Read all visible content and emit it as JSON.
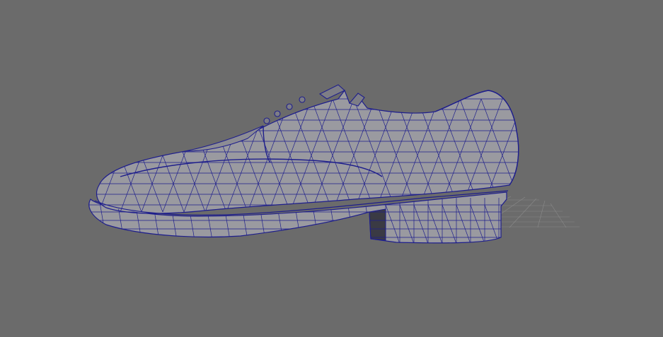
{
  "viewport": {
    "background_color": "#6b6b6b",
    "ground_grid_color": "#8a8a8a",
    "mesh_fill_color": "#9a9aa0",
    "mesh_dark_color": "#7d7d86",
    "wire_color": "#1e1e8c",
    "object": "shoe-mesh",
    "display_mode": "wireframe-on-shaded"
  }
}
